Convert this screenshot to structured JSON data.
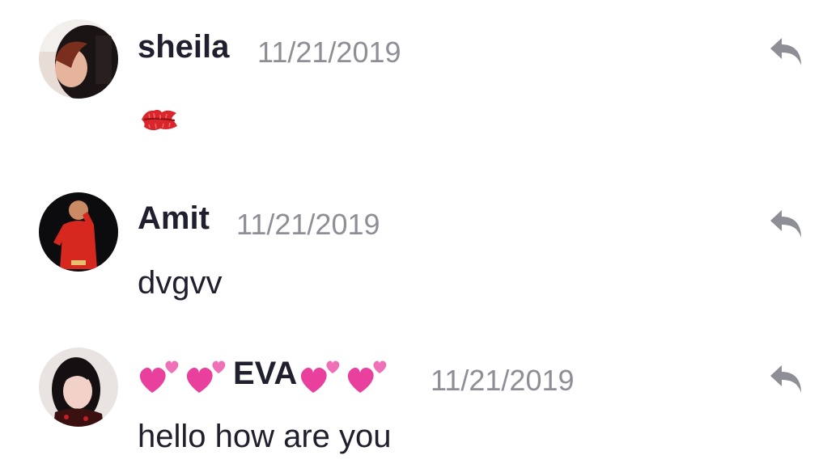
{
  "comments": [
    {
      "author": "sheila",
      "date": "11/21/2019",
      "body_icon": "kiss-mark-icon",
      "reply_icon": "reply-icon"
    },
    {
      "author": "Amit",
      "date": "11/21/2019",
      "body": "dvgvv",
      "reply_icon": "reply-icon"
    },
    {
      "author": "EVA",
      "author_decoration_icon": "two-hearts-icon",
      "date": "11/21/2019",
      "body": "hello how are you",
      "reply_icon": "reply-icon"
    }
  ],
  "colors": {
    "text": "#1f1f2e",
    "date": "#8e8e96",
    "reply_icon": "#8e8e96",
    "heart": "#e8409c",
    "kiss": "#d9262c"
  }
}
